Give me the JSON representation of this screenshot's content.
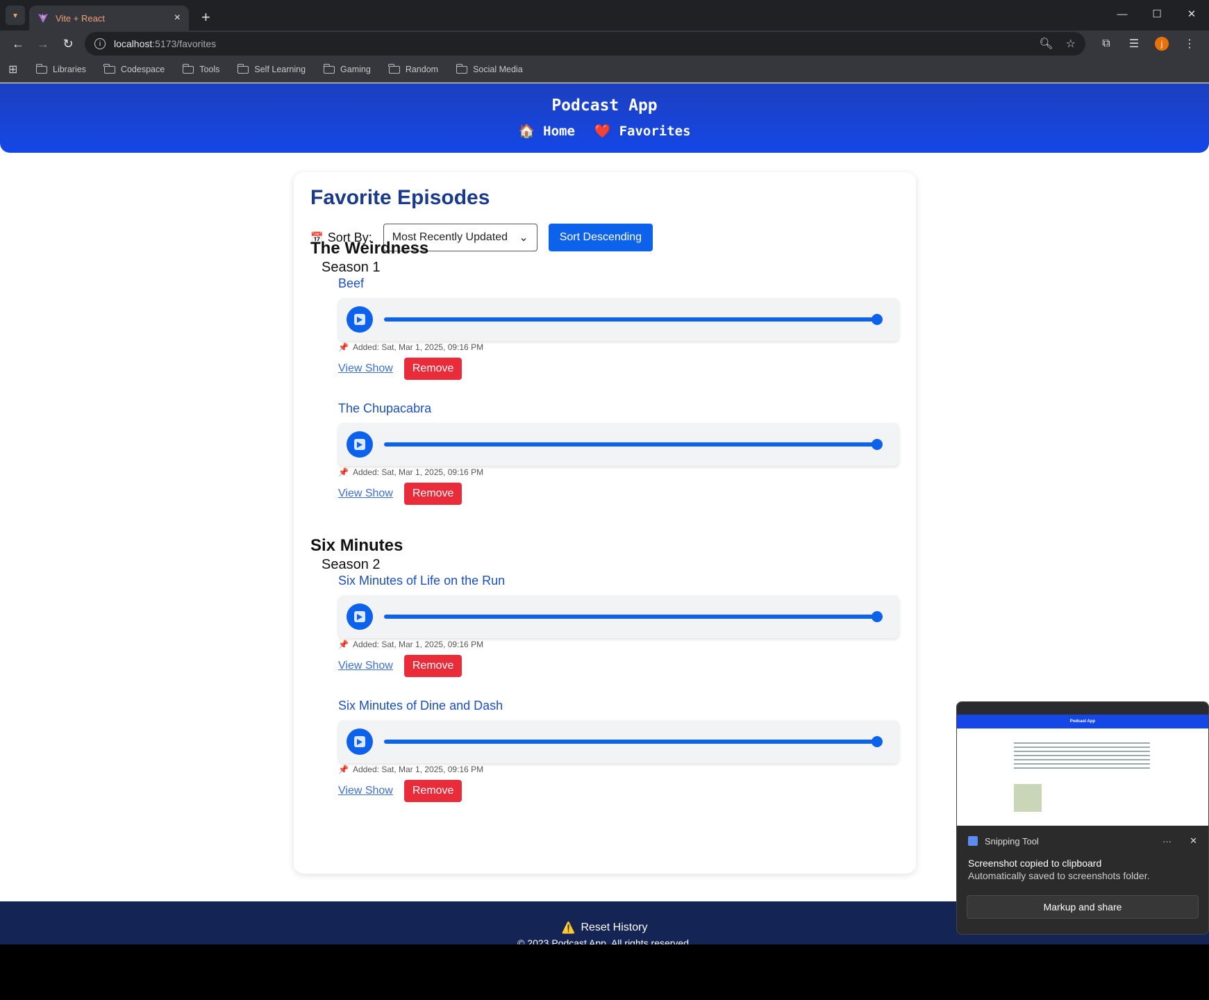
{
  "browser": {
    "tab_title": "Vite + React",
    "tab_close": "×",
    "new_tab": "+",
    "url_host": "localhost",
    "url_path": ":5173/favorites",
    "bookmarks": [
      "Libraries",
      "Codespace",
      "Tools",
      "Self Learning",
      "Gaming",
      "Random",
      "Social Media"
    ],
    "profile_initial": "j"
  },
  "header": {
    "title": "Podcast App",
    "nav": [
      {
        "icon": "🏠",
        "label": "Home"
      },
      {
        "icon": "❤️",
        "label": "Favorites"
      }
    ]
  },
  "page": {
    "title": "Favorite Episodes",
    "sort_icon": "📅",
    "sort_label": "Sort By:",
    "sort_value": "Most Recently Updated",
    "sort_button": "Sort Descending"
  },
  "shows": [
    {
      "title": "The Weirdness",
      "season": "Season 1",
      "episodes": [
        {
          "title": "Beef",
          "added": "Added: Sat, Mar 1, 2025, 09:16 PM",
          "progress": 1.0
        },
        {
          "title": "The Chupacabra",
          "added": "Added: Sat, Mar 1, 2025, 09:16 PM",
          "progress": 1.0
        }
      ]
    },
    {
      "title": "Six Minutes",
      "season": "Season 2",
      "episodes": [
        {
          "title": "Six Minutes of Life on the Run",
          "added": "Added: Sat, Mar 1, 2025, 09:16 PM",
          "progress": 1.0
        },
        {
          "title": "Six Minutes of Dine and Dash",
          "added": "Added: Sat, Mar 1, 2025, 09:16 PM",
          "progress": 1.0
        }
      ]
    }
  ],
  "actions": {
    "view_show": "View Show",
    "remove": "Remove",
    "pin": "📌"
  },
  "footer": {
    "reset_icon": "⚠️",
    "reset_label": "Reset History",
    "copyright": "© 2023 Podcast App. All rights reserved."
  },
  "toast": {
    "app_name": "Snipping Tool",
    "message": "Screenshot copied to clipboard",
    "sub": "Automatically saved to screenshots folder.",
    "button": "Markup and share",
    "more": "···",
    "close": "✕"
  },
  "colors": {
    "accent": "#0d62ec",
    "header": "#1547e6",
    "footer": "#142454",
    "remove": "#ea2b3a",
    "title": "#1a3a8c"
  }
}
